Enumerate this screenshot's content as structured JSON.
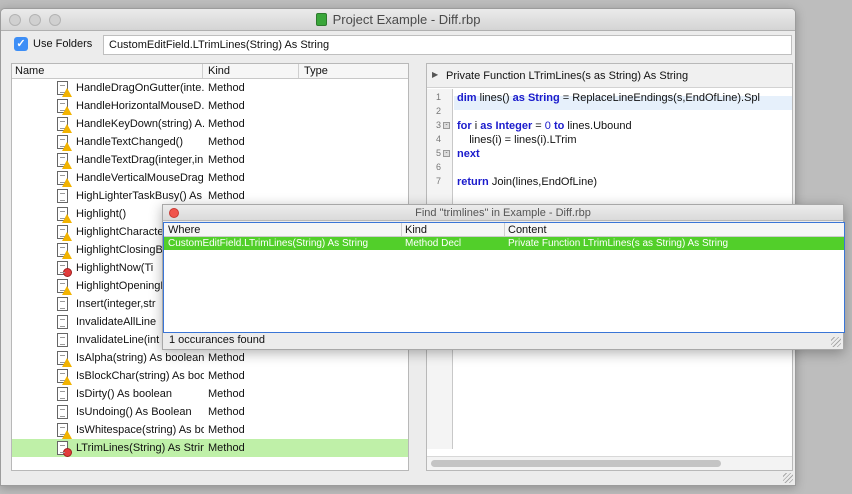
{
  "window": {
    "title": "Project Example - Diff.rbp"
  },
  "toolbar": {
    "use_folders_label": "Use Folders",
    "use_folders_checked": true,
    "path_value": "CustomEditField.LTrimLines(String) As String"
  },
  "tree": {
    "columns": [
      "Name",
      "Kind",
      "Type"
    ],
    "rows": [
      {
        "name": "HandleDragOnGutter(inte...",
        "kind": "Method",
        "badge": "warn"
      },
      {
        "name": "HandleHorizontalMouseD...",
        "kind": "Method",
        "badge": "warn"
      },
      {
        "name": "HandleKeyDown(string) A...",
        "kind": "Method",
        "badge": "warn"
      },
      {
        "name": "HandleTextChanged()",
        "kind": "Method",
        "badge": "warn"
      },
      {
        "name": "HandleTextDrag(integer,in...",
        "kind": "Method",
        "badge": "warn"
      },
      {
        "name": "HandleVerticalMouseDrag...",
        "kind": "Method",
        "badge": "warn"
      },
      {
        "name": "HighLighterTaskBusy() As ...",
        "kind": "Method",
        "badge": "none"
      },
      {
        "name": "Highlight()",
        "kind": "",
        "badge": "warn"
      },
      {
        "name": "HighlightCharacterR",
        "kind": "",
        "badge": "warn"
      },
      {
        "name": "HighlightClosingBlo",
        "kind": "",
        "badge": "warn"
      },
      {
        "name": "HighlightNow(Ti",
        "kind": "",
        "badge": "stop"
      },
      {
        "name": "HighlightOpeningBl",
        "kind": "",
        "badge": "warn"
      },
      {
        "name": "Insert(integer,str",
        "kind": "",
        "badge": "none"
      },
      {
        "name": "InvalidateAllLine",
        "kind": "",
        "badge": "none"
      },
      {
        "name": "InvalidateLine(int",
        "kind": "",
        "badge": "none"
      },
      {
        "name": "IsAlpha(string) As boolean",
        "kind": "Method",
        "badge": "warn"
      },
      {
        "name": "IsBlockChar(string) As boo...",
        "kind": "Method",
        "badge": "warn"
      },
      {
        "name": "IsDirty() As boolean",
        "kind": "Method",
        "badge": "none"
      },
      {
        "name": "IsUndoing() As Boolean",
        "kind": "Method",
        "badge": "none"
      },
      {
        "name": "IsWhitespace(string) As bo...",
        "kind": "Method",
        "badge": "warn"
      },
      {
        "name": "LTrimLines(String) As String",
        "kind": "Method",
        "badge": "stop",
        "selected": true
      }
    ]
  },
  "code": {
    "signature": "Private Function LTrimLines(s as String) As String",
    "line_numbers": [
      "1",
      "2",
      "3",
      "4",
      "5",
      "6",
      "7"
    ],
    "lines": [
      [
        "dim",
        " lines() ",
        "as",
        " ",
        "String",
        " = ReplaceLineEndings(s,EndOfLine).Spl"
      ],
      [
        ""
      ],
      [
        "for",
        " i ",
        "as",
        " ",
        "Integer",
        " = ",
        "0",
        " ",
        "to",
        " lines.Ubound"
      ],
      [
        "    lines(i) = lines(i).LTrim"
      ],
      [
        "next"
      ],
      [
        ""
      ],
      [
        "return",
        " Join(lines,EndOfLine)"
      ]
    ]
  },
  "find": {
    "title": "Find \"trimlines\" in Example - Diff.rbp",
    "columns": [
      "Where",
      "Kind",
      "Content"
    ],
    "rows": [
      {
        "where": "CustomEditField.LTrimLines(String) As String",
        "kind": "Method Decl",
        "content": "Private Function LTrimLines(s as String) As String"
      }
    ],
    "status": "1 occurances found"
  },
  "colors": {
    "match_row": "#52cf2a",
    "selected_row": "#bff0a8",
    "keyword": "#1a1acc",
    "checkbox": "#3d8ef6"
  }
}
